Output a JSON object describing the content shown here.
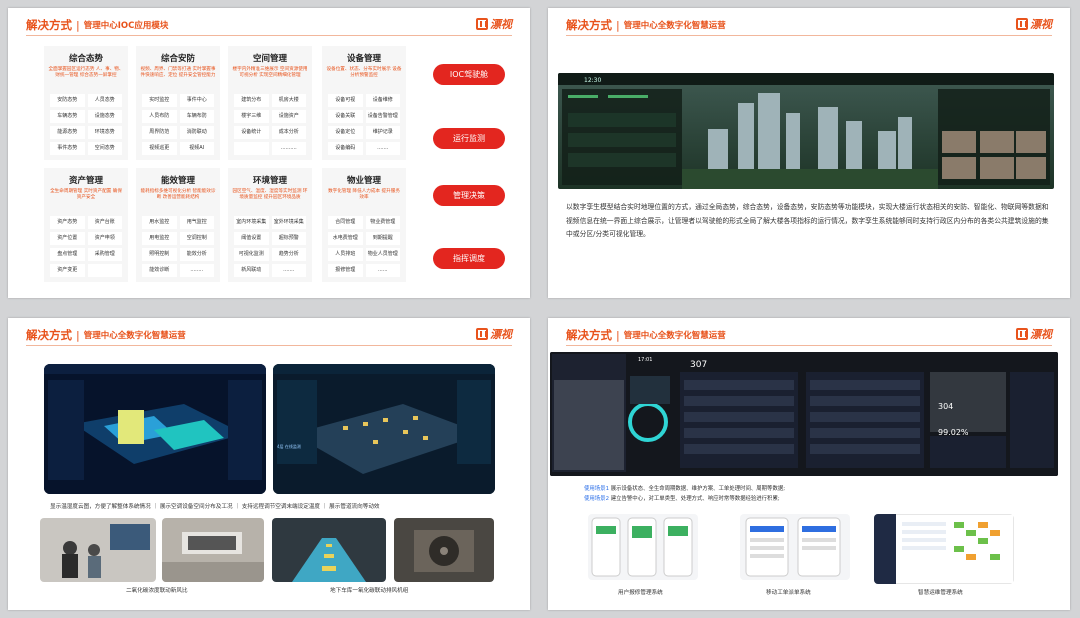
{
  "header": {
    "prefix": "解决方式",
    "separator": "|",
    "brand": "漂视"
  },
  "slide1": {
    "subtitle": "管理中心IOC应用模块",
    "cards": [
      {
        "title": "综合态势",
        "desc": "全面掌握园区运行态势 人、事、物、财统一管理 综合态势一屏掌控",
        "items": [
          "安防态势",
          "人员态势",
          "车辆态势",
          "设施态势",
          "能源态势",
          "环境态势",
          "事件态势",
          "空间态势"
        ]
      },
      {
        "title": "综合安防",
        "desc": "视频、周界、门禁等打通 实时掌握事件快速响应、定位 提升安全管控能力",
        "items": [
          "实时监控",
          "事件中心",
          "人员布防",
          "车辆布防",
          "周界防范",
          "消防联动",
          "视频巡更",
          "视频AI"
        ]
      },
      {
        "title": "空间管理",
        "desc": "楼宇内外精准三维展示 空间资源使用可视分析 实现空间精细化管理",
        "items": [
          "建筑分布",
          "机房大楼",
          "楼宇三维",
          "设施资产",
          "设备统计",
          "成本分析",
          "",
          ".........."
        ]
      },
      {
        "title": "设备管理",
        "desc": "设备位置、状态、分布实时展示 设备分析预警监控",
        "items": [
          "设备可视",
          "设备维修",
          "设备关联",
          "设备告警管理",
          "设备定位",
          "维护记录",
          "设备编码",
          "......."
        ]
      },
      {
        "title": "资产管理",
        "desc": "全生命周期管理 实时资产配置 确保资产安全",
        "items": [
          "资产态势",
          "资产台账",
          "资产位置",
          "资产申领",
          "盘点管理",
          "采购管理",
          "资产变更",
          ""
        ]
      },
      {
        "title": "能效管理",
        "desc": "能耗指标多维可视化分析 智能能效诊断 改善运营能耗结构",
        "items": [
          "用水监控",
          "用气监控",
          "用电监控",
          "空调控制",
          "照明控制",
          "能效分析",
          "能效诊断",
          "........"
        ]
      },
      {
        "title": "环境管理",
        "desc": "园区空气、温度、湿度等实时监测 环境质量监控 提升园区环境品质",
        "items": [
          "室内环境采集",
          "室外环境采集",
          "阈值设置",
          "超标预警",
          "可视化监测",
          "趋势分析",
          "新风联动",
          "......."
        ]
      },
      {
        "title": "物业管理",
        "desc": "数字化管理 降低人力成本 提升服务效率",
        "items": [
          "合同管理",
          "物业费管理",
          "水电费管理",
          "到期提醒",
          "人员排班",
          "物业人员管理",
          "报修管理",
          "......"
        ]
      }
    ],
    "buttons": [
      "IOC驾驶舱",
      "运行监测",
      "管理决策",
      "指挥调度"
    ]
  },
  "slide2": {
    "subtitle": "管理中心全数字化智慧运营",
    "dashboard_clock": "12:30",
    "paragraph": "以数字孪生模型结合实时地理位置的方式，通过全局态势，综合态势，设备态势，安防态势等功能模块，实现大楼运行状态相关的安防、智能化、物联网等数据和视频信息在统一界面上综合展示，让管理者以驾驶舱的形式全局了解大楼各项指标的运行情况，数字孪生系统能够同时支持行政区内分布的各类公共建筑设施的集中或分区/分类可视化管理。"
  },
  "slide3": {
    "subtitle": "管理中心全数字化智慧运营",
    "caption_top": "显示温湿度云图，方便了解整体系统情况 ｜ 展示空调设备空间分布及工况 ｜ 支持远程调节空调末端设定温度 ｜ 展示管道流向等动效",
    "caption_left": "二氧化碳浓度联动新风比",
    "caption_right": "地下车库一氧化碳联动排风机组",
    "screen_label": "4层 在线监测"
  },
  "slide4": {
    "subtitle": "管理中心全数字化智慧运营",
    "top_center_number": "307",
    "right_number": "304",
    "right_percent": "99.02%",
    "clock": "17:01",
    "scene1_label": "使用场景1",
    "scene1_text": "展示设备状态、全生命周期数据、维护方案、工单处理时间、周期等数据;",
    "scene2_label": "使用场景2",
    "scene2_text": "建立告警中心，对工单类型、处理方式、响应时常等数据经验进行积累;",
    "captions": [
      "用户报修管理系统",
      "移动工单派单系统",
      "智慧运维管理系统"
    ]
  },
  "colors": {
    "accent": "#e8531c",
    "button_red": "#e3261f",
    "scene_blue": "#2a6ee8"
  }
}
